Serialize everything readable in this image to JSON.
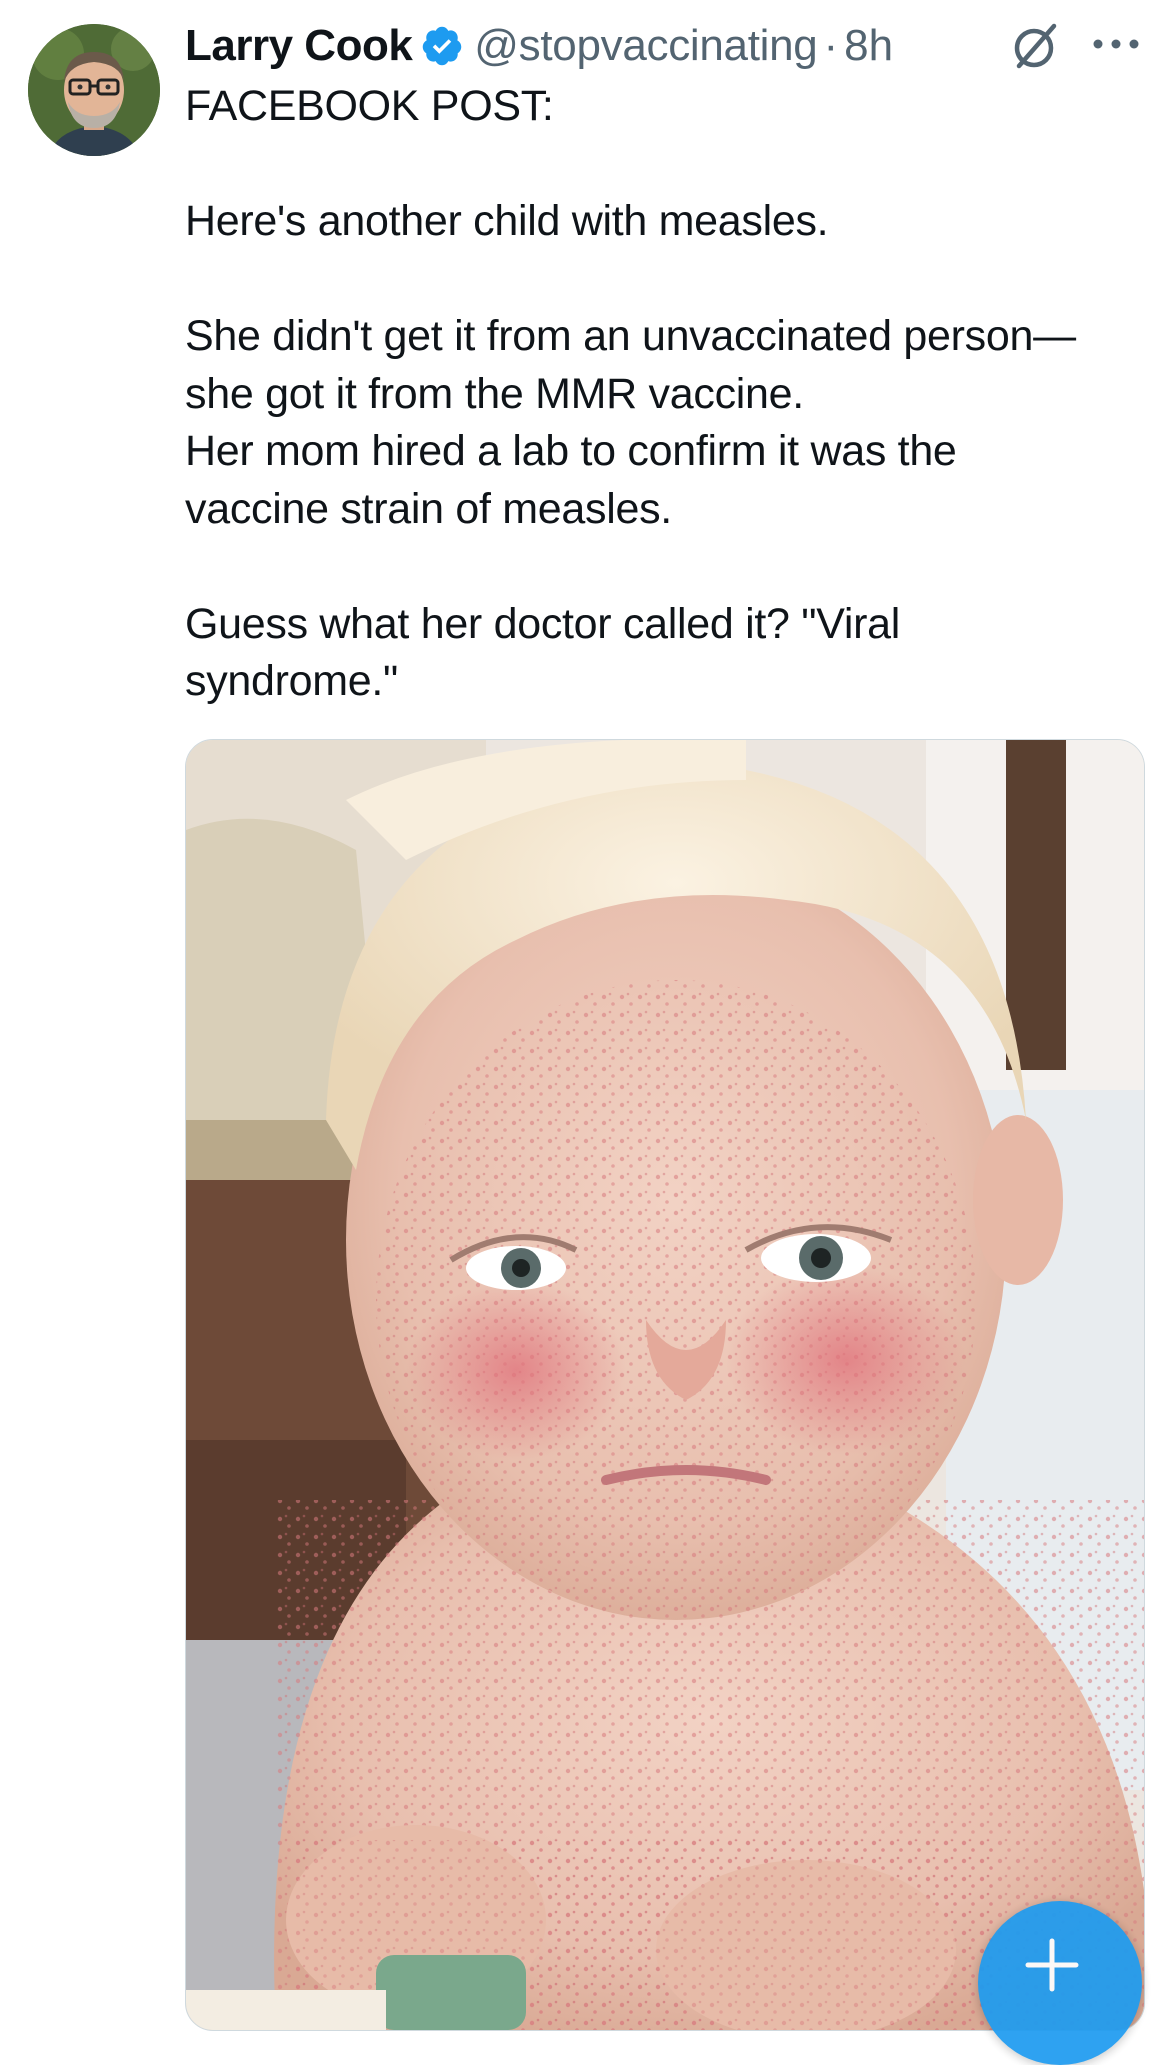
{
  "post": {
    "author": {
      "display_name": "Larry Cook",
      "handle": "@stopvaccinating",
      "verified": true,
      "avatar_icon": "profile-photo"
    },
    "separator": "·",
    "timestamp": "8h",
    "text_lines": [
      "FACEBOOK POST:",
      "",
      "Here's another child with measles.",
      "",
      "She didn't get it from an unvaccinated person—",
      "she got it from the MMR vaccine.",
      "Her mom hired a lab to confirm it was the",
      "vaccine strain of measles.",
      "",
      "Guess what her doctor called it? \"Viral",
      "syndrome.\""
    ],
    "media": {
      "type": "photo",
      "icon": "photo-child-with-rash"
    }
  },
  "actions": {
    "grok_icon": "grok-icon",
    "more_icon": "more-icon",
    "compose_fab_icon": "plus-icon"
  },
  "colors": {
    "text_primary": "#0f1419",
    "text_secondary": "#536471",
    "accent": "#1d9bf0",
    "border": "#cfd9de"
  }
}
